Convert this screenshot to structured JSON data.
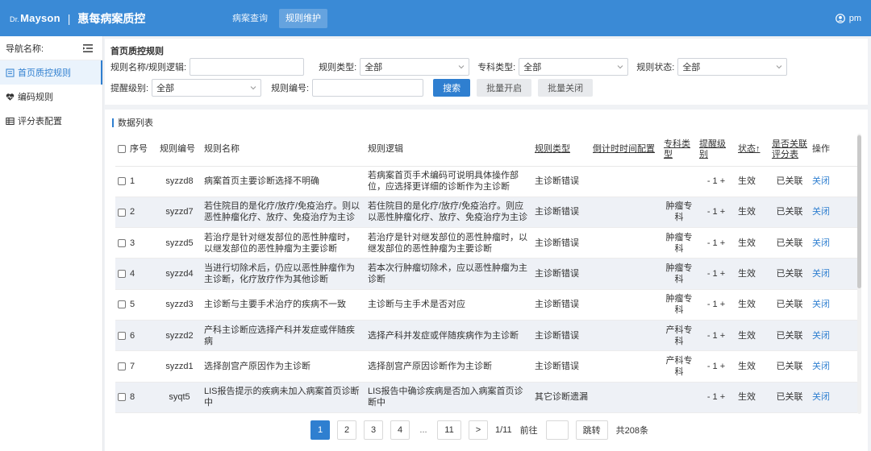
{
  "header": {
    "logo_prefix": "Dr.",
    "logo_name": "Mayson",
    "separator": "|",
    "app_title": "惠每病案质控",
    "nav": [
      {
        "label": "病案查询"
      },
      {
        "label": "规则维护"
      }
    ],
    "user": "pm"
  },
  "sidebar": {
    "title": "导航名称:",
    "items": [
      {
        "label": "首页质控规则",
        "icon": "document-icon"
      },
      {
        "label": "编码规则",
        "icon": "heart-pulse-icon"
      },
      {
        "label": "评分表配置",
        "icon": "table-icon"
      }
    ]
  },
  "filter": {
    "title": "首页质控规则",
    "rule_name_label": "规则名称/规则逻辑:",
    "rule_name_value": "",
    "rule_type_label": "规则类型:",
    "rule_type_value": "全部",
    "dept_type_label": "专科类型:",
    "dept_type_value": "全部",
    "rule_status_label": "规则状态:",
    "rule_status_value": "全部",
    "alert_level_label": "提醒级别:",
    "alert_level_value": "全部",
    "rule_no_label": "规则编号:",
    "rule_no_value": "",
    "search_label": "搜索",
    "batch_on_label": "批量开启",
    "batch_off_label": "批量关闭"
  },
  "table": {
    "title": "数据列表",
    "columns": {
      "seq": "序号",
      "no": "规则编号",
      "name": "规则名称",
      "logic": "规则逻辑",
      "type": "规则类型",
      "countdown": "倒计时时间配置",
      "dept": "专科类型",
      "level": "提醒级别",
      "status": "状态↑",
      "linked": "是否关联评分表",
      "op": "操作"
    },
    "rows": [
      {
        "seq": "1",
        "no": "syzzd8",
        "name": "病案首页主要诊断选择不明确",
        "logic": "若病案首页手术编码可说明具体操作部位，应选择更详细的诊断作为主诊断",
        "type": "主诊断错误",
        "countdown": "",
        "dept": "",
        "level": "- 1 +",
        "status": "生效",
        "linked": "已关联",
        "op": "关闭"
      },
      {
        "seq": "2",
        "no": "syzzd7",
        "name": "若住院目的是化疗/放疗/免疫治疗。则以恶性肿瘤化疗、放疗、免疫治疗为主诊断",
        "logic": "若住院目的是化疗/放疗/免疫治疗。则应以恶性肿瘤化疗、放疗、免疫治疗为主诊断",
        "type": "主诊断错误",
        "countdown": "",
        "dept": "肿瘤专科",
        "level": "- 1 +",
        "status": "生效",
        "linked": "已关联",
        "op": "关闭"
      },
      {
        "seq": "3",
        "no": "syzzd5",
        "name": "若治疗是针对继发部位的恶性肿瘤时，以继发部位的恶性肿瘤为主要诊断",
        "logic": "若治疗是针对继发部位的恶性肿瘤时，以继发部位的恶性肿瘤为主要诊断",
        "type": "主诊断错误",
        "countdown": "",
        "dept": "肿瘤专科",
        "level": "- 1 +",
        "status": "生效",
        "linked": "已关联",
        "op": "关闭"
      },
      {
        "seq": "4",
        "no": "syzzd4",
        "name": "当进行切除术后，仍应以恶性肿瘤作为主诊断，化疗放疗作为其他诊断",
        "logic": "若本次行肿瘤切除术，应以恶性肿瘤为主诊断",
        "type": "主诊断错误",
        "countdown": "",
        "dept": "肿瘤专科",
        "level": "- 1 +",
        "status": "生效",
        "linked": "已关联",
        "op": "关闭"
      },
      {
        "seq": "5",
        "no": "syzzd3",
        "name": "主诊断与主要手术治疗的疾病不一致",
        "logic": "主诊断与主手术是否对应",
        "type": "主诊断错误",
        "countdown": "",
        "dept": "肿瘤专科",
        "level": "- 1 +",
        "status": "生效",
        "linked": "已关联",
        "op": "关闭"
      },
      {
        "seq": "6",
        "no": "syzzd2",
        "name": "产科主诊断应选择产科并发症或伴随疾病",
        "logic": "选择产科并发症或伴随疾病作为主诊断",
        "type": "主诊断错误",
        "countdown": "",
        "dept": "产科专科",
        "level": "- 1 +",
        "status": "生效",
        "linked": "已关联",
        "op": "关闭"
      },
      {
        "seq": "7",
        "no": "syzzd1",
        "name": "选择剖宫产原因作为主诊断",
        "logic": "选择剖宫产原因诊断作为主诊断",
        "type": "主诊断错误",
        "countdown": "",
        "dept": "产科专科",
        "level": "- 1 +",
        "status": "生效",
        "linked": "已关联",
        "op": "关闭"
      },
      {
        "seq": "8",
        "no": "syqt5",
        "name": "LIS报告提示的疾病未加入病案首页诊断中",
        "logic": "LIS报告中确诊疾病是否加入病案首页诊断中",
        "type": "其它诊断遗漏",
        "countdown": "",
        "dept": "",
        "level": "- 1 +",
        "status": "生效",
        "linked": "已关联",
        "op": "关闭"
      }
    ]
  },
  "pagination": {
    "pages": [
      "1",
      "2",
      "3",
      "4"
    ],
    "ellipsis": "...",
    "last": "11",
    "next": ">",
    "page_info": "1/11",
    "goto_label": "前往",
    "jump_label": "跳转",
    "total": "共208条"
  },
  "colors": {
    "header_bg": "#3a8ad6",
    "primary": "#2f7fd0",
    "row_alt": "#eef1f6"
  }
}
